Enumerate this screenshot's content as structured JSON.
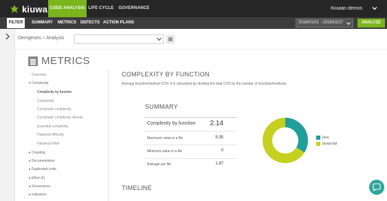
{
  "header": {
    "brand": "kiuwan",
    "tabs": [
      {
        "label": "CODE ANALYSIS",
        "active": true
      },
      {
        "label": "LIFE CYCLE",
        "active": false
      },
      {
        "label": "GOVERNANCE",
        "active": false
      }
    ],
    "account": "Kiuwan demos"
  },
  "subnav": {
    "filter_label": "FILTER",
    "tabs": [
      "SUMMARY",
      "METRICS",
      "DEFECTS",
      "ACTION PLANS"
    ],
    "date_range": "2016/01/01 - 2016/02/27",
    "analyze_label": "ANALYZE"
  },
  "breadcrumb": {
    "app": "Demgeses",
    "sep": ">",
    "page": "Analysis"
  },
  "page_title": "METRICS",
  "sidebar": {
    "items": [
      {
        "label": "Overview"
      },
      {
        "label": "▾ Complexity"
      },
      {
        "label": "Complexity by function"
      },
      {
        "label": "Complexity"
      },
      {
        "label": "Cyclomatic complexity"
      },
      {
        "label": "Cyclomatic complexity density"
      },
      {
        "label": "Essential complexity"
      },
      {
        "label": "Halstead difficulty"
      },
      {
        "label": "Halstead effort"
      },
      {
        "label": "▸ Coupling"
      },
      {
        "label": "▸ Documentation"
      },
      {
        "label": "▸ Duplicated code"
      },
      {
        "label": "▸ Effort (h)"
      },
      {
        "label": "▸ Governance"
      },
      {
        "label": "▸ Indicators"
      }
    ]
  },
  "main": {
    "section_title": "COMPLEXITY BY FUNCTION",
    "description": "Average function/method CCN. It is calculated by dividing the total CCN by the number of functions/methods.",
    "summary_title": "SUMMARY",
    "summary_rows": [
      {
        "label": "Complexity by function",
        "value": "2.14"
      },
      {
        "label": "Maximum value in a file",
        "value": "5.35"
      },
      {
        "label": "Minimum value in a file",
        "value": "0"
      },
      {
        "label": "Average per file",
        "value": "1.87"
      }
    ],
    "timeline_title": "TIMELINE"
  },
  "chart_data": {
    "type": "pie",
    "donut": true,
    "categories": [
      "Java",
      "Javascript"
    ],
    "values": [
      34,
      66
    ],
    "colors": [
      "#1f9e9a",
      "#c5d020"
    ]
  },
  "colors": {
    "accent": "#7ab51d",
    "topbar": "#262626",
    "subbar": "#3c3c3c",
    "chat": "#2fa69a"
  },
  "icons": {
    "brand": "kiuwan-leaf-icon",
    "collapse": "chevron-right-icon",
    "menu": "hamburger-icon",
    "chat": "chat-bubble-icon"
  }
}
